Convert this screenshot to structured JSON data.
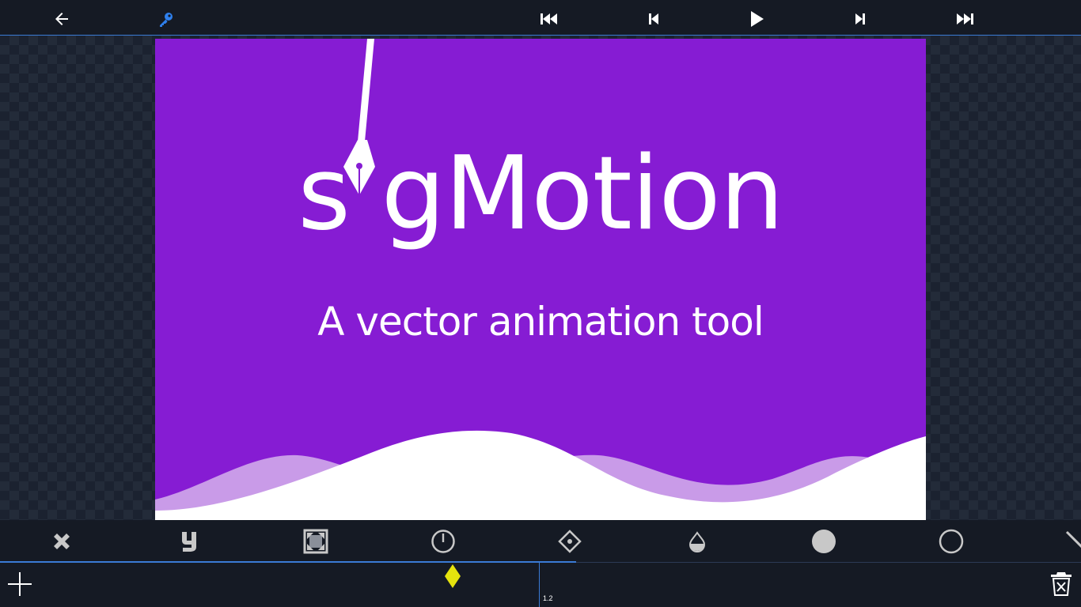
{
  "topbar": {
    "icons": [
      "back-arrow-icon",
      "key-icon",
      "skip-to-start-icon",
      "step-back-icon",
      "play-icon",
      "step-forward-icon",
      "skip-to-end-icon"
    ]
  },
  "canvas": {
    "logo_text": "s gMotion",
    "tagline": "A vector animation tool",
    "background_color": "#861cd3",
    "wave_light_color": "#c99be8",
    "wave_white_color": "#ffffff"
  },
  "toolbar": {
    "tools": [
      "close-icon",
      "y-letter-icon",
      "fit-frame-icon",
      "timer-icon",
      "anchor-point-icon",
      "opacity-drop-icon",
      "fill-circle-icon",
      "stroke-circle-icon",
      "line-tool-icon"
    ]
  },
  "timeline": {
    "time_label": "1.2",
    "keyframe_color": "#e5e30d",
    "accent_color": "#3a7bd5"
  }
}
